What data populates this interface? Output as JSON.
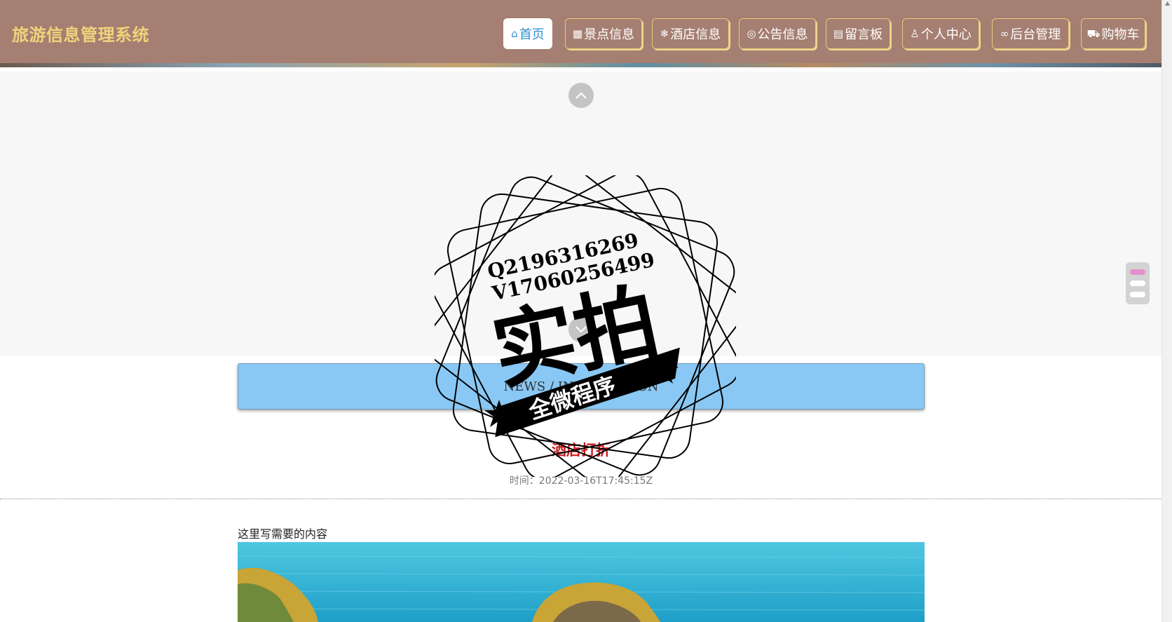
{
  "header": {
    "brand": "旅游信息管理系统",
    "nav": [
      {
        "label": "首页",
        "icon": "home-icon",
        "active": true
      },
      {
        "label": "景点信息",
        "icon": "grid-icon",
        "active": false
      },
      {
        "label": "酒店信息",
        "icon": "snowflake-icon",
        "active": false
      },
      {
        "label": "公告信息",
        "icon": "palette-icon",
        "active": false
      },
      {
        "label": "留言板",
        "icon": "board-icon",
        "active": false
      },
      {
        "label": "个人中心",
        "icon": "user-icon",
        "active": false
      },
      {
        "label": "后台管理",
        "icon": "link-icon",
        "active": false
      },
      {
        "label": "购物车",
        "icon": "cart-icon",
        "active": false
      }
    ]
  },
  "carousel": {
    "active_dot": 0,
    "dot_count": 3
  },
  "section": {
    "title": "NEWS / INFORMATION"
  },
  "article": {
    "title": "酒店打折",
    "time": "时间：2022-03-16T17:45:15Z",
    "body": "这里写需要的内容"
  },
  "watermark": {
    "line1": "Q2196316269",
    "line2": "V17060256499",
    "main": "实拍",
    "ribbon": "全微程序"
  },
  "colors": {
    "header_bg": "#a57f72",
    "brand": "#f2d27b",
    "active_nav_text": "#2a8fd6",
    "section_bg": "#89c8f4",
    "article_title": "#c81d1d",
    "dot_active": "#e38fcf"
  }
}
